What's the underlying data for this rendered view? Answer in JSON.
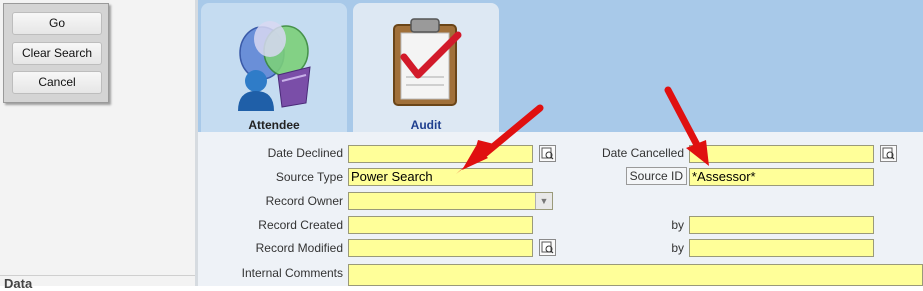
{
  "left_panel": {
    "buttons": [
      "Go",
      "Clear Search",
      "Cancel"
    ],
    "section_label": "Data"
  },
  "tabs": [
    {
      "label": "Attendee",
      "icon": "attendee-icon",
      "active": false
    },
    {
      "label": "Audit",
      "icon": "clipboard-check-icon",
      "active": true
    }
  ],
  "form": {
    "date_declined": {
      "label": "Date Declined",
      "value": ""
    },
    "date_cancelled": {
      "label": "Date Cancelled",
      "value": ""
    },
    "source_type": {
      "label": "Source Type",
      "value": "Power Search"
    },
    "source_id": {
      "label": "Source ID",
      "value": "*Assessor*"
    },
    "record_owner": {
      "label": "Record Owner",
      "value": ""
    },
    "record_created": {
      "label": "Record Created",
      "value": "",
      "by_label": "by",
      "by_value": ""
    },
    "record_modified": {
      "label": "Record Modified",
      "value": "",
      "by_label": "by",
      "by_value": ""
    },
    "internal_comments": {
      "label": "Internal Comments",
      "value": ""
    }
  },
  "colors": {
    "field_bg": "#ffff99",
    "tab_area": "#a8c9e9",
    "annotation_arrow": "#e01010"
  }
}
